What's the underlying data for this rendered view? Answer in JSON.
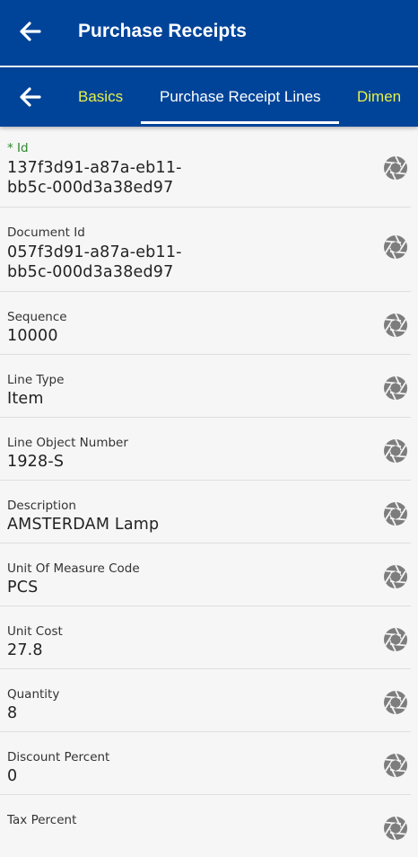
{
  "header": {
    "title": "Purchase Receipts"
  },
  "tabs": [
    {
      "label": "Basics"
    },
    {
      "label": "Purchase Receipt Lines"
    },
    {
      "label": "Dimen"
    }
  ],
  "colors": {
    "bar": "#004499",
    "tab_inactive": "#e8f04a",
    "required": "#2a8a2a"
  },
  "fields": [
    {
      "label": "* Id",
      "value_line1": "137f3d91-a87a-eb11-",
      "value_line2": "bb5c-000d3a38ed97"
    },
    {
      "label": "Document Id",
      "value_line1": "057f3d91-a87a-eb11-",
      "value_line2": "bb5c-000d3a38ed97"
    },
    {
      "label": "Sequence",
      "value": "10000"
    },
    {
      "label": "Line Type",
      "value": "Item"
    },
    {
      "label": "Line Object Number",
      "value": "1928-S"
    },
    {
      "label": "Description",
      "value": "AMSTERDAM Lamp"
    },
    {
      "label": "Unit Of Measure Code",
      "value": "PCS"
    },
    {
      "label": "Unit Cost",
      "value": "27.8"
    },
    {
      "label": "Quantity",
      "value": "8"
    },
    {
      "label": "Discount Percent",
      "value": "0"
    },
    {
      "label": "Tax Percent",
      "value": ""
    }
  ],
  "icons": {
    "back": "arrow-left-icon",
    "field_action": "camera-shutter-icon"
  }
}
